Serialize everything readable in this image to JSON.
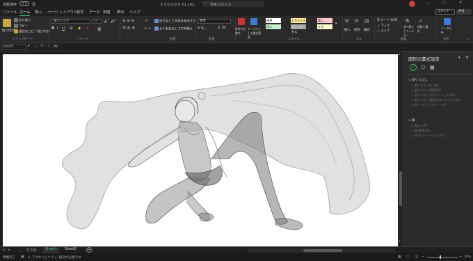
{
  "titlebar": {
    "autosave_label": "自動保存",
    "autosave_state": "オフ",
    "filename": "えろなんかな 01.xlsx",
    "search_placeholder": "検索 (Alt+Q)",
    "comment_label": "コメント",
    "share_label": "共有"
  },
  "tabs": [
    "ファイル",
    "ホーム",
    "挿入",
    "ページ レイアウト",
    "数式",
    "データ",
    "校閲",
    "表示",
    "ヘルプ"
  ],
  "active_tab": "ホーム",
  "ribbon": {
    "clipboard": {
      "paste": "貼り付け",
      "cut": "切り取り",
      "copy": "コピー",
      "format_painter": "書式のコピー/貼り付け",
      "group": "クリップボード"
    },
    "font": {
      "name": "游ゴシック",
      "size": "11",
      "group": "フォント"
    },
    "alignment": {
      "wrap": "折り返して全体を表示する",
      "merge": "セルを結合して中央揃え",
      "group": "配置"
    },
    "number": {
      "format": "標準",
      "group": "数値"
    },
    "styles": {
      "conditional": "条件付き書式",
      "table": "テーブルとして書式設定",
      "cells": [
        {
          "label": "標準",
          "color": "#ffffff"
        },
        {
          "label": "どちらでもない",
          "color": "#ffeb9c"
        },
        {
          "label": "悪い",
          "color": "#ffc7ce"
        },
        {
          "label": "良い",
          "color": "#c6efce"
        },
        {
          "label": "チェック セル",
          "color": "#a5a5a5"
        },
        {
          "label": "メモ",
          "color": "#ffffcc"
        }
      ],
      "group": "スタイル"
    },
    "cells": {
      "insert": "挿入",
      "delete": "削除",
      "format": "書式",
      "group": "セル"
    },
    "editing": {
      "autosum": "オート SUM",
      "fill": "フィル",
      "clear": "クリア",
      "sort": "並べ替えとフィルター",
      "find": "検索と選択",
      "group": "編集"
    },
    "analysis": {
      "analyze": "データ分析",
      "group": "分析"
    }
  },
  "formula_bar": {
    "name_box": "EH271",
    "fx": "fx",
    "value": ""
  },
  "pane": {
    "title": "図形の書式設定",
    "fill_section": "塗りつぶし",
    "fill_options": [
      "塗りつぶしなし(N)",
      "塗りつぶし (単色)(S)",
      "塗りつぶし (グラデーション)(G)",
      "塗りつぶし (図またはテクスチャ)(P)",
      "塗りつぶし (パターン)(A)"
    ],
    "line_section": "線",
    "line_options": [
      "線なし(N)",
      "線 (単色)(S)",
      "線 (グラデーション)(G)"
    ]
  },
  "sheet_tabs": [
    "ラフ01",
    "Sheet1",
    "Sheet2"
  ],
  "active_sheet": "Sheet1",
  "status": {
    "mode": "準備完了",
    "accessibility": "アクセシビリティ: 検討が必要です",
    "zoom": "29%"
  }
}
